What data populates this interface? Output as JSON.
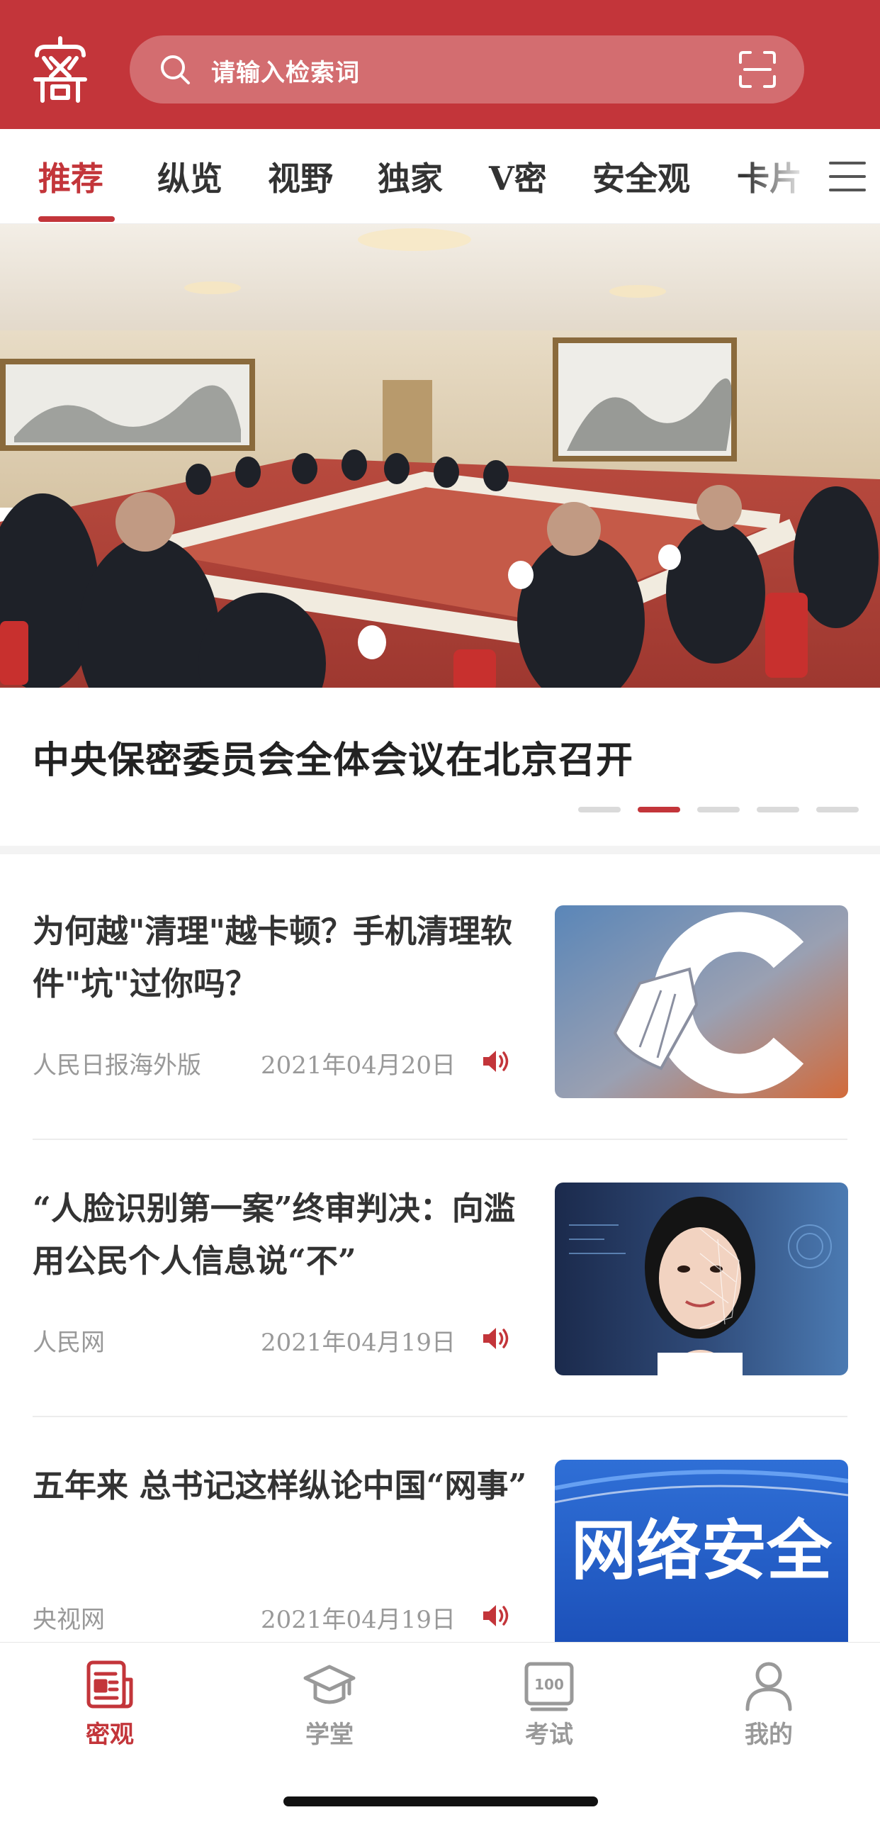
{
  "header": {
    "search_placeholder": "请输入检索词",
    "logo_icon": "seal-logo-icon",
    "scan_icon": "scan-icon",
    "brand_color": "#c3353a"
  },
  "tabs": {
    "items": [
      {
        "label": "推荐",
        "active": true
      },
      {
        "label": "纵览"
      },
      {
        "label": "视野"
      },
      {
        "label": "独家"
      },
      {
        "label": "V密"
      },
      {
        "label": "安全观"
      },
      {
        "label": "卡片"
      }
    ],
    "menu_icon": "menu-lines-icon"
  },
  "banner": {
    "title": "中央保密委员会全体会议在北京召开",
    "slides_total": 5,
    "active_slide": 2
  },
  "news": [
    {
      "title": "为何越\"清理\"越卡顿？手机清理软件\"坑\"过你吗？",
      "source": "人民日报海外版",
      "date": "2021年04月20日",
      "thumb_text": ""
    },
    {
      "title": "“人脸识别第一案”终审判决：向滥用公民个人信息说“不”",
      "source": "人民网",
      "date": "2021年04月19日",
      "thumb_text": ""
    },
    {
      "title": "五年来 总书记这样纵论中国“网事”",
      "source": "央视网",
      "date": "2021年04月19日",
      "thumb_text": "网络安全"
    }
  ],
  "bottom_nav": [
    {
      "label": "密观",
      "icon": "newspaper-icon",
      "active": true
    },
    {
      "label": "学堂",
      "icon": "graduation-cap-icon"
    },
    {
      "label": "考试",
      "icon": "score-100-icon"
    },
    {
      "label": "我的",
      "icon": "person-icon"
    }
  ]
}
